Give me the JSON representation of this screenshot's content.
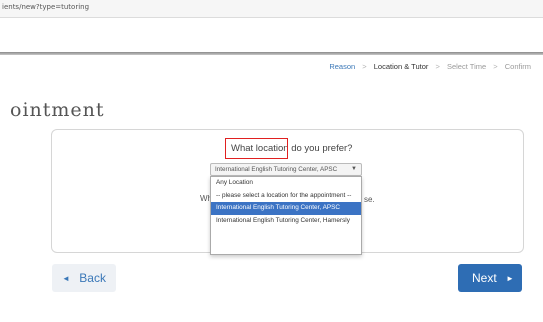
{
  "browser": {
    "url": "ients/new?type=tutoring"
  },
  "steps": [
    "Reason",
    "Location & Tutor",
    "Select Time",
    "Confirm"
  ],
  "steps_separator": ">",
  "page_title": "ointment",
  "question": "What location do you prefer?",
  "location_select": {
    "selected": "International English Tutoring Center, APSC",
    "options": [
      "Any Location",
      "-- please select a location for the appointment --",
      "International English Tutoring Center, APSC",
      "International English Tutoring Center, Hamersly"
    ],
    "highlighted_index": 2
  },
  "obscured_text": {
    "left": "Wh",
    "right_top": "",
    "right_bottom": "se."
  },
  "buttons": {
    "back": "Back",
    "next": "Next"
  },
  "icons": {
    "back": "◄",
    "next": "►",
    "caret": "▼"
  },
  "colors": {
    "accent": "#2e6db4",
    "highlight_box": "#e02020"
  }
}
